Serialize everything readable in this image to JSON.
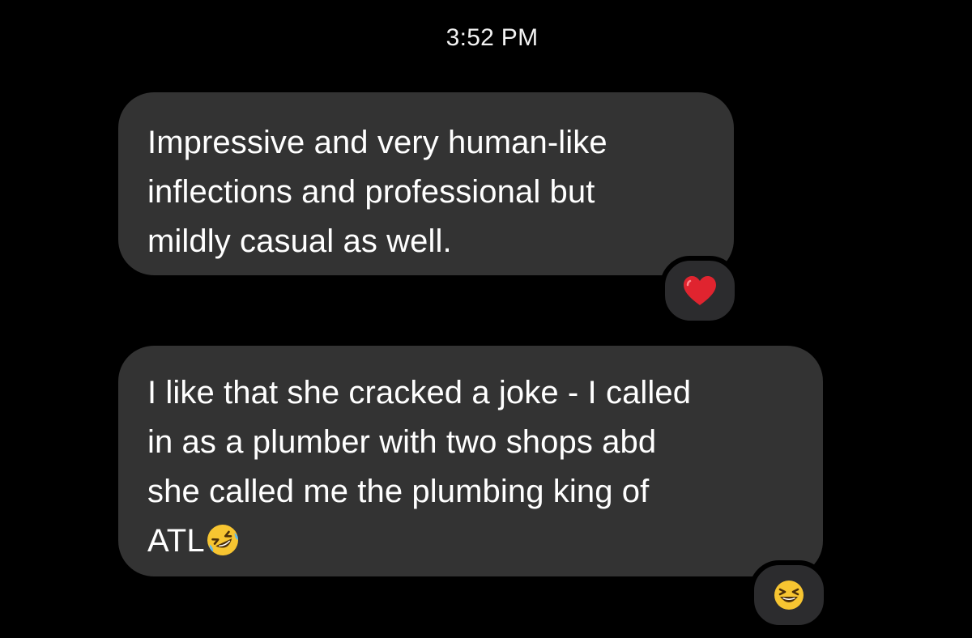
{
  "conversation": {
    "timestamp": "3:52 PM",
    "messages": [
      {
        "text": "Impressive and very human-like\ninflections and professional but\nmildly casual as well.",
        "reaction": "heart-icon"
      },
      {
        "text": "I like that she cracked a joke - I called\nin as a plumber with two shops abd\nshe called me the plumbing king of\nATL",
        "inline_emoji": "rofl-emoji-icon",
        "reaction": "laughing-emoji-icon"
      }
    ]
  },
  "colors": {
    "background": "#000000",
    "bubble": "#333333",
    "reaction_badge": "#2c2c2e",
    "text": "#ffffff",
    "heart": "#e0242f",
    "emoji": "#f7c531"
  }
}
